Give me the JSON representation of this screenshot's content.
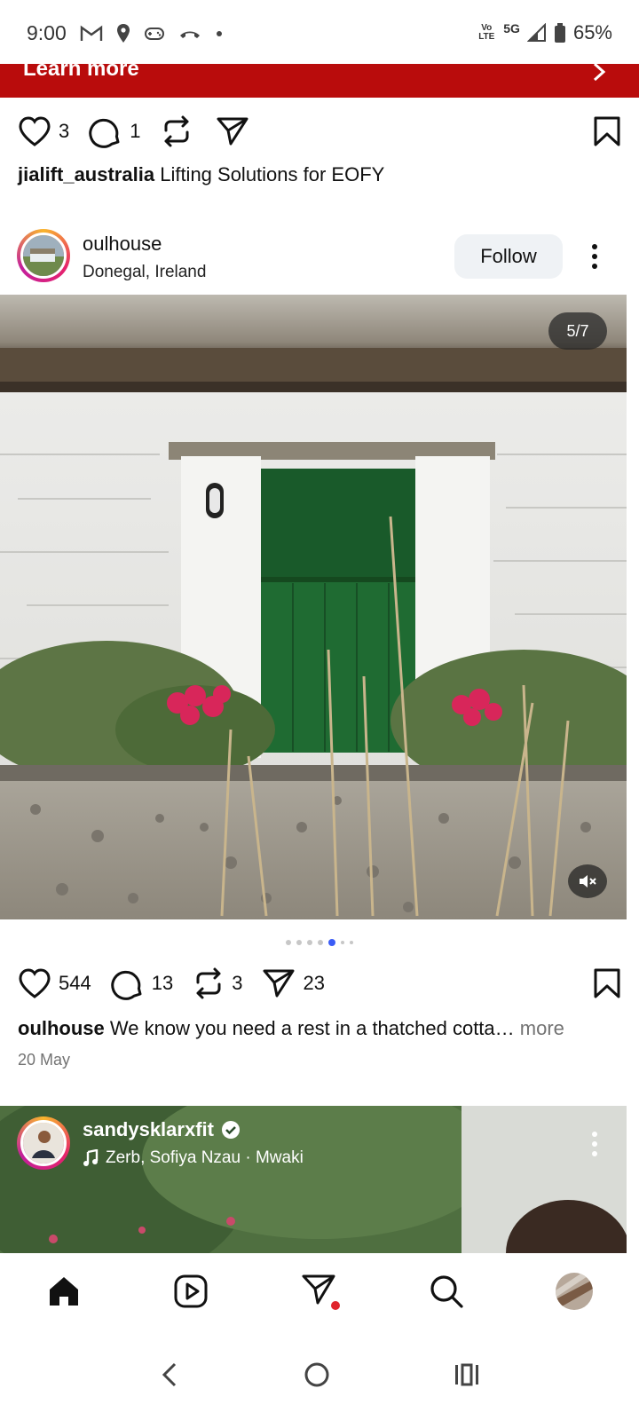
{
  "status_bar": {
    "time": "9:00",
    "network": "5G",
    "battery": "65%",
    "lte": "Vo LTE"
  },
  "ad_banner": {
    "label": "Learn more",
    "color": "#b90c0c"
  },
  "post1": {
    "likes": "3",
    "comments": "1",
    "username": "jialift_australia",
    "caption": "Lifting Solutions for EOFY"
  },
  "post2": {
    "username": "oulhouse",
    "location": "Donegal, Ireland",
    "follow_label": "Follow",
    "counter": "5/7",
    "likes": "544",
    "comments": "13",
    "reposts": "3",
    "shares": "23",
    "caption_user": "oulhouse",
    "caption_text": "We know you need a rest in a thatched cotta…",
    "more_label": "more",
    "date": "20 May"
  },
  "post3": {
    "username": "sandysklarxfit",
    "audio": "Zerb, Sofiya Nzau · Mwaki"
  },
  "bottom_nav": {
    "items": [
      "home-icon",
      "reels-icon",
      "messages-icon",
      "search-icon",
      "profile-avatar"
    ]
  },
  "colors": {
    "accent_blue": "#3b5cf6",
    "notification_red": "#e0242c",
    "verified_blue": "#0095f6"
  }
}
